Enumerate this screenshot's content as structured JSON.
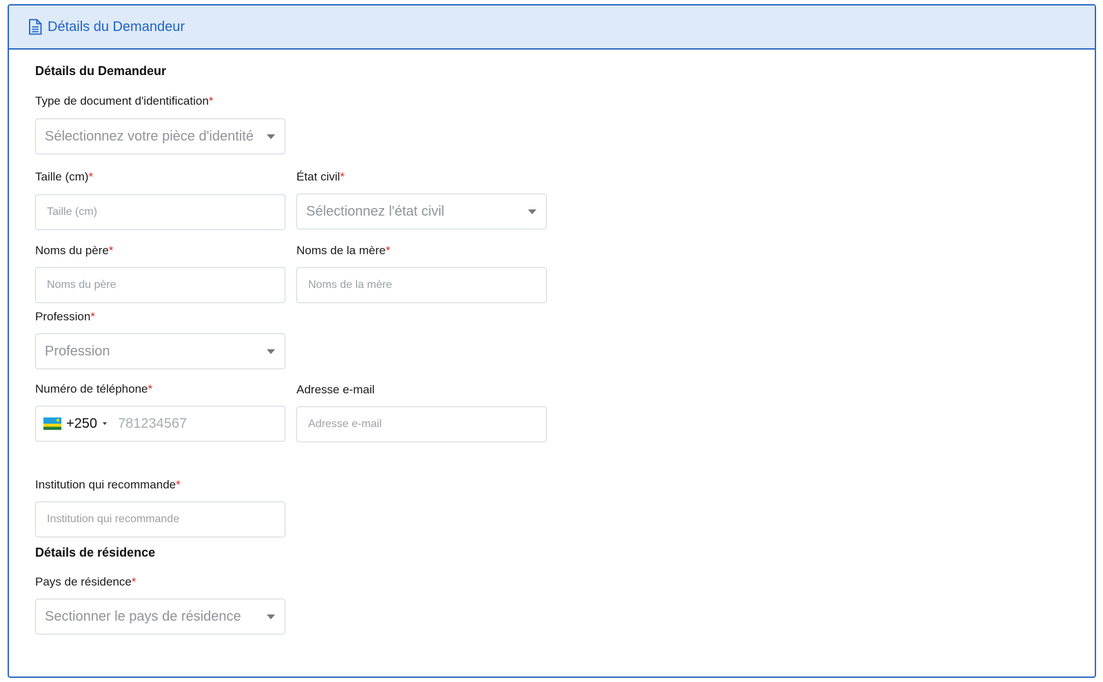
{
  "header": {
    "title": "Détails du Demandeur",
    "icon": "document-icon",
    "accent_color": "#1f63c6",
    "background_color": "#deeaf8"
  },
  "applicant": {
    "section_title": "Détails du Demandeur",
    "required_marker": "*",
    "id_type": {
      "label": "Type de document d'identification",
      "placeholder": "Sélectionnez votre pièce d'identité"
    },
    "height": {
      "label": "Taille (cm)",
      "placeholder": "Taille (cm)"
    },
    "civil_status": {
      "label": "État civil",
      "placeholder": "Sélectionnez l'état civil"
    },
    "father": {
      "label": "Noms du père",
      "placeholder": "Noms du père"
    },
    "mother": {
      "label": "Noms de la mère",
      "placeholder": "Noms de la mère"
    },
    "profession": {
      "label": "Profession",
      "placeholder": "Profession"
    },
    "phone": {
      "label": "Numéro de téléphone",
      "country_code": "+250",
      "placeholder": "781234567",
      "flag": "rwanda-flag-icon"
    },
    "email": {
      "label": "Adresse e-mail",
      "placeholder": "Adresse e-mail"
    },
    "institution": {
      "label": "Institution qui recommande",
      "placeholder": "Institution qui recommande"
    }
  },
  "residence": {
    "section_title": "Détails de résidence",
    "country": {
      "label": "Pays de résidence",
      "placeholder": "Sectionner le pays de résidence"
    }
  }
}
